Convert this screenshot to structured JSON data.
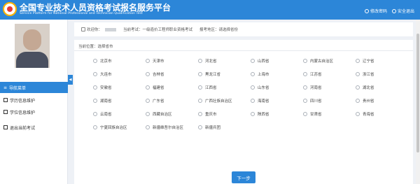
{
  "header": {
    "title": "全国专业技术人员资格考试报名服务平台",
    "subtitle": "Service Platform for National Professional and Technician Qualification Test",
    "change_password": "修改密码",
    "logout": "安全退出"
  },
  "sidebar": {
    "items": [
      {
        "label": "导航菜单"
      },
      {
        "label": "学历信息维护"
      },
      {
        "label": "学位信息维护"
      },
      {
        "label": "退出当前考试"
      }
    ]
  },
  "info": {
    "welcome": "欢迎你：",
    "current_exam": "当前考试：一级造价工程师职业资格考试",
    "region": "报考地区：请选择省份"
  },
  "panel": {
    "position": "当前位置：选择省市",
    "provinces": [
      "北京市",
      "天津市",
      "河北省",
      "山西省",
      "内蒙古自治区",
      "辽宁省",
      "大连市",
      "吉林省",
      "黑龙江省",
      "上海市",
      "江苏省",
      "浙江省",
      "安徽省",
      "福建省",
      "江西省",
      "山东省",
      "河南省",
      "湖北省",
      "湖南省",
      "广东省",
      "广西壮族自治区",
      "海南省",
      "四川省",
      "贵州省",
      "云南省",
      "西藏自治区",
      "重庆市",
      "陕西省",
      "甘肃省",
      "青海省",
      "宁夏回族自治区",
      "新疆维吾尔自治区",
      "新疆兵团"
    ],
    "next_label": "下一步"
  },
  "colors": {
    "accent": "#2c86d8",
    "background": "#eef1f6"
  }
}
